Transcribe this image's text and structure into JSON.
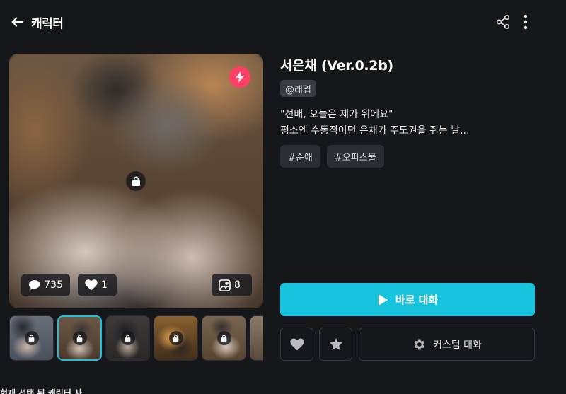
{
  "header": {
    "back_icon": "arrow-left-icon",
    "title": "캐릭터",
    "share_icon": "share-icon",
    "more_icon": "more-vertical-icon"
  },
  "hero": {
    "badge_icon": "lightning-icon",
    "badge_color": "#ff3f66",
    "lock_icon": "lock-icon",
    "comments_count": "735",
    "likes_count": "1",
    "images_count": "8"
  },
  "thumbnails": [
    {
      "label": "thumbnail-1",
      "locked": true
    },
    {
      "label": "thumbnail-2",
      "locked": true,
      "selected": true
    },
    {
      "label": "thumbnail-3",
      "locked": true
    },
    {
      "label": "thumbnail-4",
      "locked": true
    },
    {
      "label": "thumbnail-5",
      "locked": true
    },
    {
      "label": "thumbnail-6",
      "locked": false
    }
  ],
  "character": {
    "name": "서은채 (Ver.0.2b)",
    "author": "@래엽",
    "description_line1": "\"선배, 오늘은 제가 위에요\"",
    "description_line2": "평소엔 수동적이던 은채가 주도권을 쥐는 날...",
    "tags": [
      "#순애",
      "#오피스물"
    ]
  },
  "actions": {
    "start_label": "바로 대화",
    "start_color": "#18c3dd",
    "like_icon": "heart-icon",
    "favorite_icon": "star-icon",
    "custom_label": "커스텀 대화",
    "custom_icon": "gear-icon"
  },
  "section_peek": "현재 선택 된 캐릭터 사"
}
